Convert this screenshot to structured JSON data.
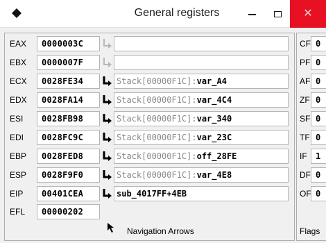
{
  "window": {
    "title": "General registers",
    "icon": "diamond-icon",
    "buttons": {
      "minimize": "minimize-icon",
      "maximize": "maximize-icon",
      "close": "close-icon"
    }
  },
  "registers": [
    {
      "name": "EAX",
      "value": "0000003C",
      "arrow_active": false,
      "ref_prefix": "",
      "ref_suffix": ""
    },
    {
      "name": "EBX",
      "value": "0000007F",
      "arrow_active": false,
      "ref_prefix": "",
      "ref_suffix": ""
    },
    {
      "name": "ECX",
      "value": "0028FE34",
      "arrow_active": true,
      "ref_prefix": "Stack[00000F1C]:",
      "ref_suffix": "var_A4"
    },
    {
      "name": "EDX",
      "value": "0028FA14",
      "arrow_active": true,
      "ref_prefix": "Stack[00000F1C]:",
      "ref_suffix": "var_4C4"
    },
    {
      "name": "ESI",
      "value": "0028FB98",
      "arrow_active": true,
      "ref_prefix": "Stack[00000F1C]:",
      "ref_suffix": "var_340"
    },
    {
      "name": "EDI",
      "value": "0028FC9C",
      "arrow_active": true,
      "ref_prefix": "Stack[00000F1C]:",
      "ref_suffix": "var_23C"
    },
    {
      "name": "EBP",
      "value": "0028FED8",
      "arrow_active": true,
      "ref_prefix": "Stack[00000F1C]:",
      "ref_suffix": "off_28FE"
    },
    {
      "name": "ESP",
      "value": "0028F9F0",
      "arrow_active": true,
      "ref_prefix": "Stack[00000F1C]:",
      "ref_suffix": "var_4E8"
    },
    {
      "name": "EIP",
      "value": "00401CEA",
      "arrow_active": true,
      "ref_prefix": "",
      "ref_suffix": "sub_4017FF+4EB"
    }
  ],
  "efl": {
    "name": "EFL",
    "value": "00000202"
  },
  "navigation": {
    "label": "Navigation Arrows",
    "icon": "cursor-arrow-icon"
  },
  "flags": [
    {
      "name": "CF",
      "value": "0"
    },
    {
      "name": "PF",
      "value": "0"
    },
    {
      "name": "AF",
      "value": "0"
    },
    {
      "name": "ZF",
      "value": "0"
    },
    {
      "name": "SF",
      "value": "0"
    },
    {
      "name": "TF",
      "value": "0"
    },
    {
      "name": "IF",
      "value": "1"
    },
    {
      "name": "DF",
      "value": "0"
    },
    {
      "name": "OF",
      "value": "0"
    }
  ],
  "flags_label": "Flags",
  "colors": {
    "close_button": "#e81123",
    "ref_prefix": "#8a8a8a",
    "arrow_active": "#000000",
    "arrow_inactive": "#b8b8b8"
  }
}
